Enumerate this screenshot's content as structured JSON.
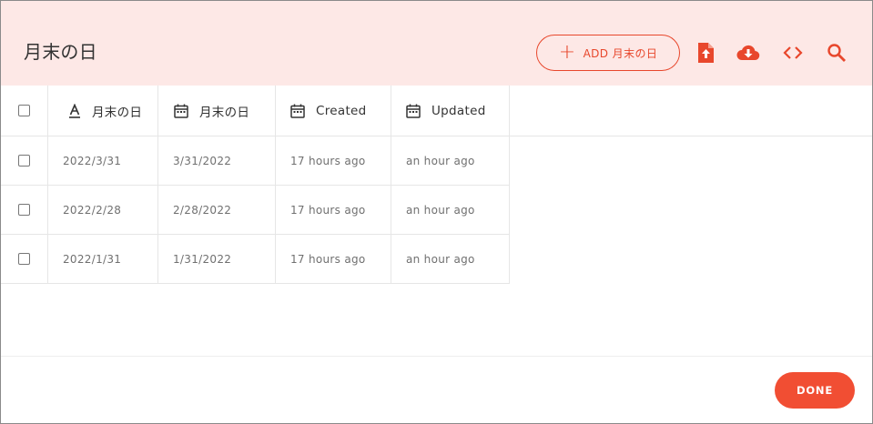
{
  "dialog": {
    "title": "月末の日",
    "add_button_label": "ADD 月末の日",
    "toolbar_icons": [
      "upload-icon",
      "download-icon",
      "code-icon",
      "search-icon"
    ],
    "accent_color": "#e8472c",
    "header_bg": "#fde8e6"
  },
  "table": {
    "columns": [
      {
        "label": "月末の日",
        "icon": "text-icon"
      },
      {
        "label": "月末の日",
        "icon": "calendar-icon"
      },
      {
        "label": "Created",
        "icon": "calendar-icon"
      },
      {
        "label": "Updated",
        "icon": "calendar-icon"
      }
    ],
    "rows": [
      [
        "2022/3/31",
        "3/31/2022",
        "17 hours ago",
        "an hour ago"
      ],
      [
        "2022/2/28",
        "2/28/2022",
        "17 hours ago",
        "an hour ago"
      ],
      [
        "2022/1/31",
        "1/31/2022",
        "17 hours ago",
        "an hour ago"
      ]
    ]
  },
  "footer": {
    "done_label": "DONE"
  }
}
